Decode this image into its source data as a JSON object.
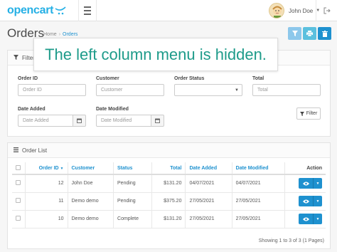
{
  "header": {
    "logo_text": "opencart",
    "user_name": "John Doe"
  },
  "page": {
    "title": "Orders",
    "breadcrumb": [
      "Home",
      "Orders"
    ]
  },
  "banner": {
    "text": "The left column menu is hidden."
  },
  "filter": {
    "heading": "Filter",
    "order_id": {
      "label": "Order ID",
      "placeholder": "Order ID"
    },
    "customer": {
      "label": "Customer",
      "placeholder": "Customer"
    },
    "order_status": {
      "label": "Order Status",
      "value": ""
    },
    "total": {
      "label": "Total",
      "placeholder": "Total"
    },
    "date_added": {
      "label": "Date Added",
      "placeholder": "Date Added"
    },
    "date_modified": {
      "label": "Date Modified",
      "placeholder": "Date Modified"
    },
    "button_label": "Filter"
  },
  "list": {
    "heading": "Order List",
    "columns": [
      "Order ID",
      "Customer",
      "Status",
      "Total",
      "Date Added",
      "Date Modified",
      "Action"
    ],
    "rows": [
      {
        "order_id": "12",
        "customer": "John Doe",
        "status": "Pending",
        "total": "$131.20",
        "date_added": "04/07/2021",
        "date_modified": "04/07/2021"
      },
      {
        "order_id": "11",
        "customer": "Demo demo",
        "status": "Pending",
        "total": "$375.20",
        "date_added": "27/05/2021",
        "date_modified": "27/05/2021"
      },
      {
        "order_id": "10",
        "customer": "Demo demo",
        "status": "Complete",
        "total": "$131.20",
        "date_added": "27/05/2021",
        "date_modified": "27/05/2021"
      }
    ],
    "showing": "Showing 1 to 3 of 3 (1 Pages)"
  },
  "colors": {
    "primary": "#1e91cf",
    "info": "#5bc0de",
    "banner_text": "#1e9b8a",
    "logo": "#25b0e5"
  },
  "icons": [
    "hamburger-icon",
    "user-avatar",
    "logout-icon",
    "filter-icon",
    "print-icon",
    "trash-icon",
    "calendar-icon",
    "list-icon",
    "eye-icon",
    "caret-down-icon"
  ]
}
